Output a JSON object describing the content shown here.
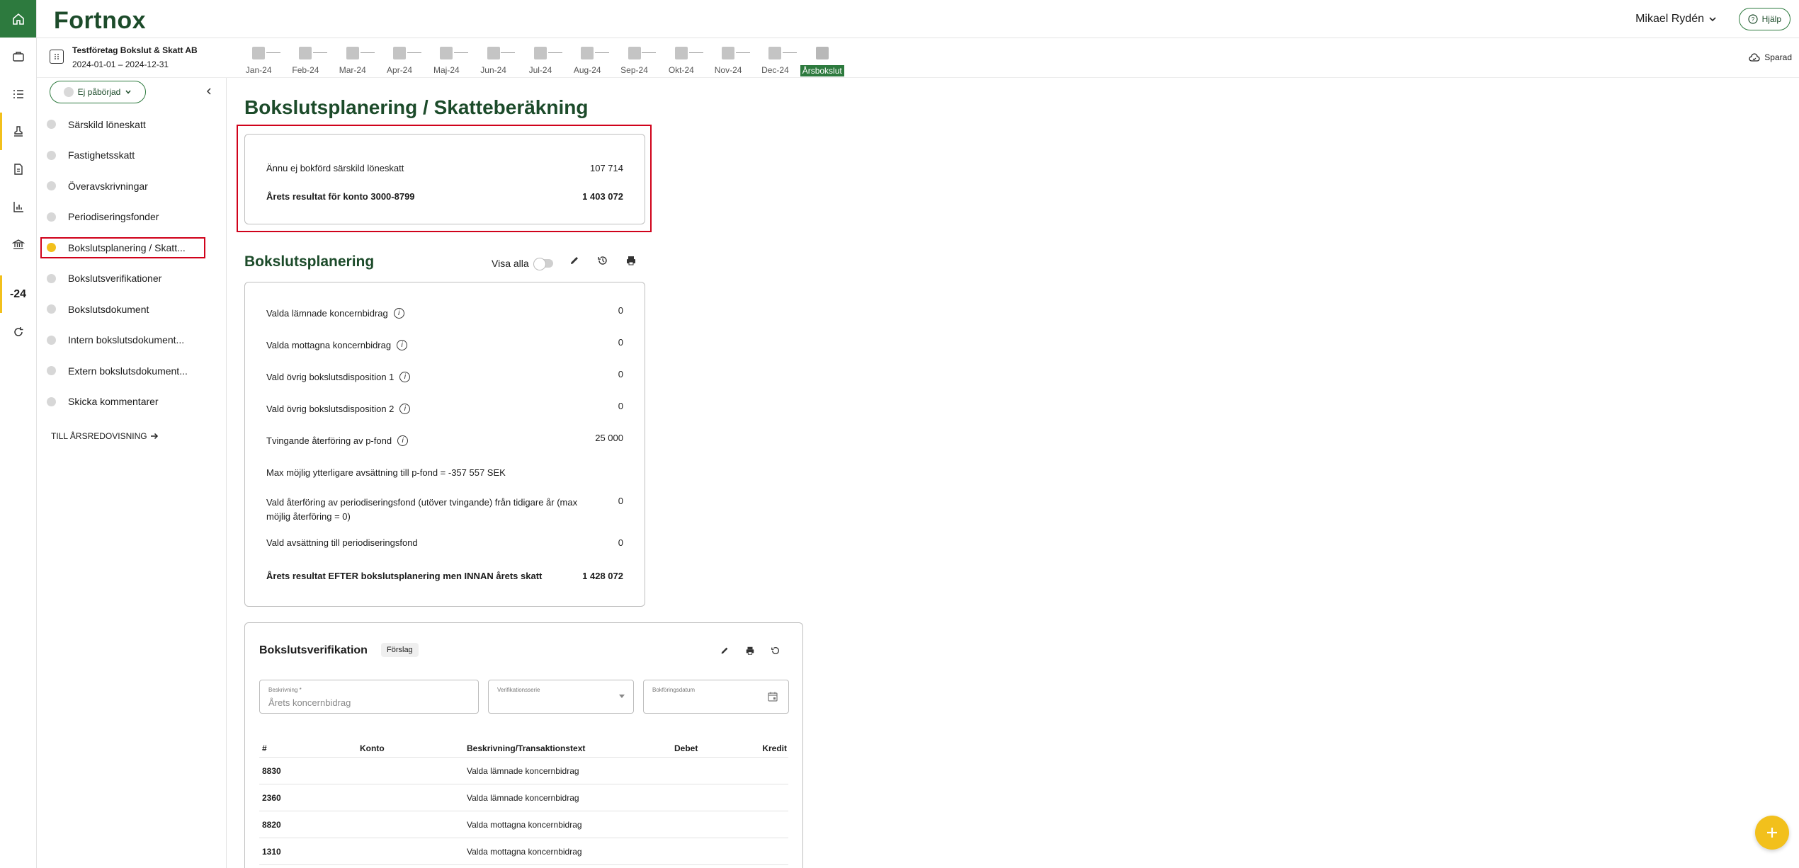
{
  "header": {
    "logo": "Fortnox",
    "user_name": "Mikael Rydén",
    "help_label": "Hjälp"
  },
  "rail": {
    "year_label": "-24"
  },
  "company": {
    "name": "Testföretag Bokslut & Skatt AB",
    "period": "2024-01-01 – 2024-12-31"
  },
  "timeline": {
    "months": [
      "Jan-24",
      "Feb-24",
      "Mar-24",
      "Apr-24",
      "Maj-24",
      "Jun-24",
      "Jul-24",
      "Aug-24",
      "Sep-24",
      "Okt-24",
      "Nov-24",
      "Dec-24",
      "Årsbokslut"
    ],
    "current": "Årsbokslut"
  },
  "saved_label": "Sparad",
  "sidebar": {
    "status": "Ej påbörjad",
    "items": [
      {
        "label": "Särskild löneskatt"
      },
      {
        "label": "Fastighetsskatt"
      },
      {
        "label": "Överavskrivningar"
      },
      {
        "label": "Periodiseringsfonder"
      },
      {
        "label": "Bokslutsplanering / Skatt..."
      },
      {
        "label": "Bokslutsverifikationer"
      },
      {
        "label": "Bokslutsdokument"
      },
      {
        "label": "Intern bokslutsdokument..."
      },
      {
        "label": "Extern bokslutsdokument..."
      },
      {
        "label": "Skicka kommentarer"
      }
    ],
    "active_index": 4,
    "to_annual": "TILL ÅRSREDOVISNING"
  },
  "page": {
    "title": "Bokslutsplanering / Skatteberäkning",
    "summary": [
      {
        "label": "Ännu ej bokförd särskild löneskatt",
        "value": "107 714"
      },
      {
        "label": "Årets resultat för konto 3000-8799",
        "value": "1 403 072"
      }
    ]
  },
  "planning": {
    "title": "Bokslutsplanering",
    "visa_alla": "Visa alla",
    "rows": [
      {
        "label": "Valda lämnade koncernbidrag",
        "value": "0"
      },
      {
        "label": "Valda mottagna koncernbidrag",
        "value": "0"
      },
      {
        "label": "Vald övrig bokslutsdisposition 1",
        "value": "0"
      },
      {
        "label": "Vald övrig bokslutsdisposition 2",
        "value": "0"
      },
      {
        "label": "Tvingande återföring av p-fond",
        "value": "25 000"
      }
    ],
    "max_note": "Max möjlig ytterligare avsättning till p-fond = -357 557 SEK",
    "reversal_line1": "Vald återföring av periodiseringsfond (utöver tvingande) från tidigare år (max",
    "reversal_line2": "möjlig återföring = 0)",
    "reversal_value": "0",
    "allocation_label": "Vald avsättning till periodiseringsfond",
    "allocation_value": "0",
    "total_label": "Årets resultat EFTER bokslutsplanering men INNAN årets skatt",
    "total_value": "1 428 072"
  },
  "verification": {
    "title": "Bokslutsverifikation",
    "badge": "Förslag",
    "fields": {
      "description_label": "Beskrivning *",
      "description_value": "Årets koncernbidrag",
      "series_label": "Verifikationsserie",
      "date_label": "Bokföringsdatum"
    },
    "columns": [
      "#",
      "Konto",
      "Beskrivning/Transaktionstext",
      "Debet",
      "Kredit"
    ],
    "rows": [
      {
        "num": "8830",
        "text": "Valda lämnade koncernbidrag"
      },
      {
        "num": "2360",
        "text": "Valda lämnade koncernbidrag"
      },
      {
        "num": "8820",
        "text": "Valda mottagna koncernbidrag"
      },
      {
        "num": "1310",
        "text": "Valda mottagna koncernbidrag"
      }
    ]
  },
  "colors": {
    "brand_green": "#2d7a3e",
    "title_green": "#1c4b2a",
    "accent_yellow": "#f2c01c",
    "highlight_red": "#d0021b"
  }
}
